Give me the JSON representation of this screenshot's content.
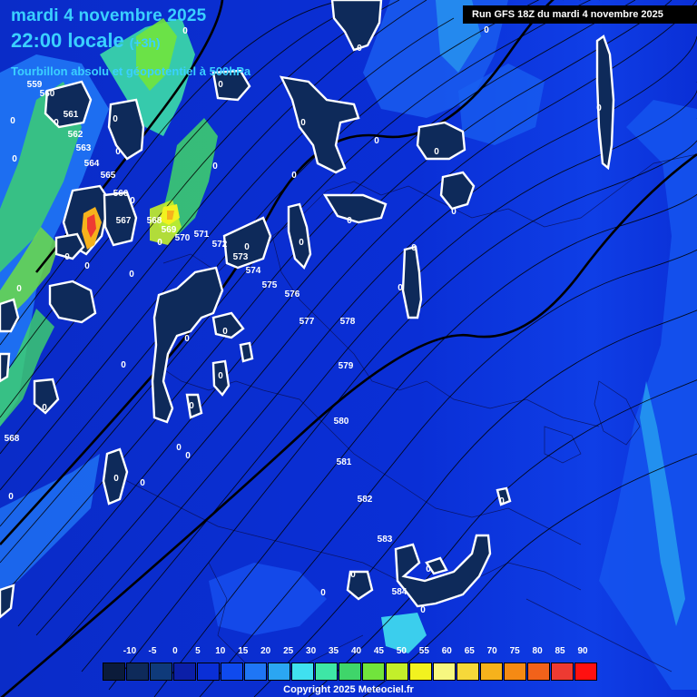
{
  "header": {
    "date": "mardi 4 novembre 2025",
    "time": "22:00 locale",
    "offset": "(+3h)",
    "subtitle": "Tourbillon absolu et géopotentiel à 500hPa"
  },
  "run_info": "Run GFS 18Z du mardi 4 novembre 2025",
  "isohypses": [
    {
      "label": "559",
      "value": 559
    },
    {
      "label": "560",
      "value": 560
    },
    {
      "label": "561",
      "value": 561
    },
    {
      "label": "562",
      "value": 562
    },
    {
      "label": "563",
      "value": 563
    },
    {
      "label": "564",
      "value": 564
    },
    {
      "label": "565",
      "value": 565
    },
    {
      "label": "566",
      "value": 566
    },
    {
      "label": "567",
      "value": 567
    },
    {
      "label": "568",
      "value": 568
    },
    {
      "label": "569",
      "value": 569
    },
    {
      "label": "570",
      "value": 570
    },
    {
      "label": "571",
      "value": 571
    },
    {
      "label": "572",
      "value": 572
    },
    {
      "label": "573",
      "value": 573
    },
    {
      "label": "574",
      "value": 574
    },
    {
      "label": "575",
      "value": 575
    },
    {
      "label": "576",
      "value": 576
    },
    {
      "label": "577",
      "value": 577
    },
    {
      "label": "578",
      "value": 578
    },
    {
      "label": "579",
      "value": 579
    },
    {
      "label": "580",
      "value": 580
    },
    {
      "label": "581",
      "value": 581
    },
    {
      "label": "582",
      "value": 582
    },
    {
      "label": "583",
      "value": 583
    },
    {
      "label": "584",
      "value": 584
    },
    {
      "label": "568",
      "value": 568
    }
  ],
  "zero_contour_label": "0",
  "legend": {
    "labels": [
      "-10",
      "-5",
      "0",
      "5",
      "10",
      "15",
      "20",
      "25",
      "30",
      "35",
      "40",
      "45",
      "50",
      "55",
      "60",
      "65",
      "70",
      "75",
      "80",
      "85",
      "90"
    ],
    "colors": [
      "#0b1b3a",
      "#0e2a5a",
      "#0f3a7a",
      "#0b1fa8",
      "#0a2fd6",
      "#0f4aee",
      "#1f76f5",
      "#2ba6f2",
      "#40e0f0",
      "#3ee6a6",
      "#3fd56a",
      "#71e43c",
      "#c3ef2a",
      "#f2f21f",
      "#f7f780",
      "#f6d83a",
      "#f6b21c",
      "#f58a14",
      "#f2621a",
      "#ee3a32",
      "#ff1010"
    ]
  },
  "copyright": "Copyright 2025 Meteociel.fr"
}
